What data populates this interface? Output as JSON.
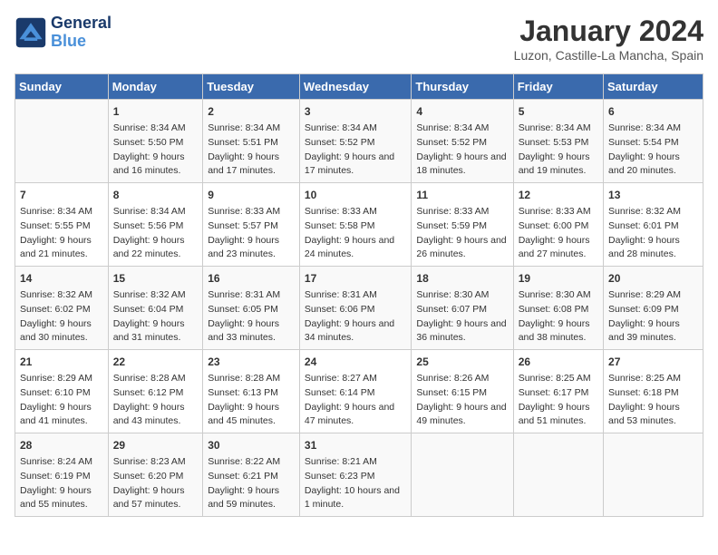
{
  "logo": {
    "line1": "General",
    "line2": "Blue"
  },
  "title": "January 2024",
  "subtitle": "Luzon, Castille-La Mancha, Spain",
  "weekdays": [
    "Sunday",
    "Monday",
    "Tuesday",
    "Wednesday",
    "Thursday",
    "Friday",
    "Saturday"
  ],
  "weeks": [
    [
      {
        "day": "",
        "content": ""
      },
      {
        "day": "1",
        "content": "Sunrise: 8:34 AM\nSunset: 5:50 PM\nDaylight: 9 hours\nand 16 minutes."
      },
      {
        "day": "2",
        "content": "Sunrise: 8:34 AM\nSunset: 5:51 PM\nDaylight: 9 hours\nand 17 minutes."
      },
      {
        "day": "3",
        "content": "Sunrise: 8:34 AM\nSunset: 5:52 PM\nDaylight: 9 hours\nand 17 minutes."
      },
      {
        "day": "4",
        "content": "Sunrise: 8:34 AM\nSunset: 5:52 PM\nDaylight: 9 hours\nand 18 minutes."
      },
      {
        "day": "5",
        "content": "Sunrise: 8:34 AM\nSunset: 5:53 PM\nDaylight: 9 hours\nand 19 minutes."
      },
      {
        "day": "6",
        "content": "Sunrise: 8:34 AM\nSunset: 5:54 PM\nDaylight: 9 hours\nand 20 minutes."
      }
    ],
    [
      {
        "day": "7",
        "content": "Sunrise: 8:34 AM\nSunset: 5:55 PM\nDaylight: 9 hours\nand 21 minutes."
      },
      {
        "day": "8",
        "content": "Sunrise: 8:34 AM\nSunset: 5:56 PM\nDaylight: 9 hours\nand 22 minutes."
      },
      {
        "day": "9",
        "content": "Sunrise: 8:33 AM\nSunset: 5:57 PM\nDaylight: 9 hours\nand 23 minutes."
      },
      {
        "day": "10",
        "content": "Sunrise: 8:33 AM\nSunset: 5:58 PM\nDaylight: 9 hours\nand 24 minutes."
      },
      {
        "day": "11",
        "content": "Sunrise: 8:33 AM\nSunset: 5:59 PM\nDaylight: 9 hours\nand 26 minutes."
      },
      {
        "day": "12",
        "content": "Sunrise: 8:33 AM\nSunset: 6:00 PM\nDaylight: 9 hours\nand 27 minutes."
      },
      {
        "day": "13",
        "content": "Sunrise: 8:32 AM\nSunset: 6:01 PM\nDaylight: 9 hours\nand 28 minutes."
      }
    ],
    [
      {
        "day": "14",
        "content": "Sunrise: 8:32 AM\nSunset: 6:02 PM\nDaylight: 9 hours\nand 30 minutes."
      },
      {
        "day": "15",
        "content": "Sunrise: 8:32 AM\nSunset: 6:04 PM\nDaylight: 9 hours\nand 31 minutes."
      },
      {
        "day": "16",
        "content": "Sunrise: 8:31 AM\nSunset: 6:05 PM\nDaylight: 9 hours\nand 33 minutes."
      },
      {
        "day": "17",
        "content": "Sunrise: 8:31 AM\nSunset: 6:06 PM\nDaylight: 9 hours\nand 34 minutes."
      },
      {
        "day": "18",
        "content": "Sunrise: 8:30 AM\nSunset: 6:07 PM\nDaylight: 9 hours\nand 36 minutes."
      },
      {
        "day": "19",
        "content": "Sunrise: 8:30 AM\nSunset: 6:08 PM\nDaylight: 9 hours\nand 38 minutes."
      },
      {
        "day": "20",
        "content": "Sunrise: 8:29 AM\nSunset: 6:09 PM\nDaylight: 9 hours\nand 39 minutes."
      }
    ],
    [
      {
        "day": "21",
        "content": "Sunrise: 8:29 AM\nSunset: 6:10 PM\nDaylight: 9 hours\nand 41 minutes."
      },
      {
        "day": "22",
        "content": "Sunrise: 8:28 AM\nSunset: 6:12 PM\nDaylight: 9 hours\nand 43 minutes."
      },
      {
        "day": "23",
        "content": "Sunrise: 8:28 AM\nSunset: 6:13 PM\nDaylight: 9 hours\nand 45 minutes."
      },
      {
        "day": "24",
        "content": "Sunrise: 8:27 AM\nSunset: 6:14 PM\nDaylight: 9 hours\nand 47 minutes."
      },
      {
        "day": "25",
        "content": "Sunrise: 8:26 AM\nSunset: 6:15 PM\nDaylight: 9 hours\nand 49 minutes."
      },
      {
        "day": "26",
        "content": "Sunrise: 8:25 AM\nSunset: 6:17 PM\nDaylight: 9 hours\nand 51 minutes."
      },
      {
        "day": "27",
        "content": "Sunrise: 8:25 AM\nSunset: 6:18 PM\nDaylight: 9 hours\nand 53 minutes."
      }
    ],
    [
      {
        "day": "28",
        "content": "Sunrise: 8:24 AM\nSunset: 6:19 PM\nDaylight: 9 hours\nand 55 minutes."
      },
      {
        "day": "29",
        "content": "Sunrise: 8:23 AM\nSunset: 6:20 PM\nDaylight: 9 hours\nand 57 minutes."
      },
      {
        "day": "30",
        "content": "Sunrise: 8:22 AM\nSunset: 6:21 PM\nDaylight: 9 hours\nand 59 minutes."
      },
      {
        "day": "31",
        "content": "Sunrise: 8:21 AM\nSunset: 6:23 PM\nDaylight: 10 hours\nand 1 minute."
      },
      {
        "day": "",
        "content": ""
      },
      {
        "day": "",
        "content": ""
      },
      {
        "day": "",
        "content": ""
      }
    ]
  ]
}
